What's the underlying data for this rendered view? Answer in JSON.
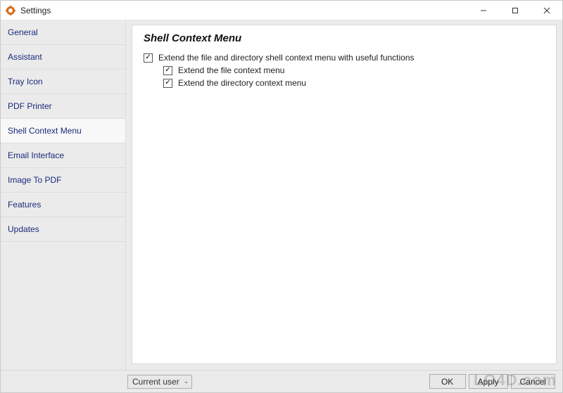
{
  "window": {
    "title": "Settings"
  },
  "sidebar": {
    "items": [
      {
        "label": "General"
      },
      {
        "label": "Assistant"
      },
      {
        "label": "Tray Icon"
      },
      {
        "label": "PDF Printer"
      },
      {
        "label": "Shell Context Menu"
      },
      {
        "label": "Email Interface"
      },
      {
        "label": "Image To PDF"
      },
      {
        "label": "Features"
      },
      {
        "label": "Updates"
      }
    ],
    "selected_index": 4
  },
  "content": {
    "heading": "Shell Context Menu",
    "options": {
      "extend_main": {
        "label": "Extend the file and directory shell context menu with useful functions",
        "checked": true
      },
      "extend_file": {
        "label": "Extend the file context menu",
        "checked": true
      },
      "extend_directory": {
        "label": "Extend the directory context menu",
        "checked": true
      }
    }
  },
  "footer": {
    "scope_dropdown": {
      "value": "Current user"
    },
    "buttons": {
      "ok": "OK",
      "apply": "Apply",
      "cancel": "Cancel"
    }
  },
  "watermark": "LO4D.com"
}
